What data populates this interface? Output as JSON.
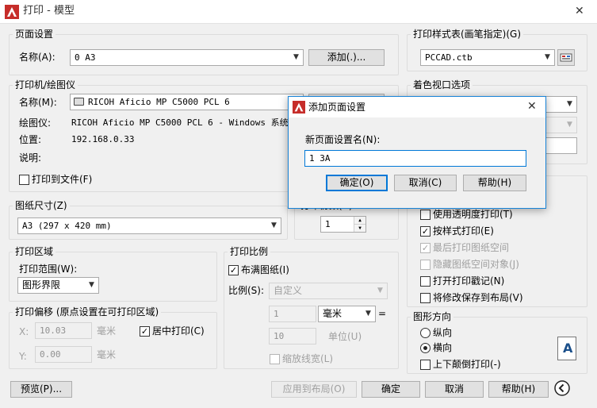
{
  "window": {
    "title": "打印 - 模型",
    "close_glyph": "✕"
  },
  "page_setup": {
    "title": "页面设置",
    "name_label": "名称(A):",
    "name_value": "0  A3",
    "add_button": "添加(.)..."
  },
  "printer": {
    "title": "打印机/绘图仪",
    "name_label": "名称(M):",
    "name_value": "RICOH Aficio MP C5000 PCL 6",
    "plotter_label": "绘图仪:",
    "plotter_value": "RICOH Aficio MP C5000 PCL 6 - Windows 系统...",
    "location_label": "位置:",
    "location_value": "192.168.0.33",
    "desc_label": "说明:",
    "print_to_file": "打印到文件(F)"
  },
  "paper_size": {
    "title": "图纸尺寸(Z)",
    "value": "A3 (297 x 420 mm)"
  },
  "copies": {
    "title": "打印份数(B)",
    "value": "1"
  },
  "plot_area": {
    "title": "打印区域",
    "range_label": "打印范围(W):",
    "range_value": "图形界限"
  },
  "plot_offset": {
    "title": "打印偏移 (原点设置在可打印区域)",
    "x_label": "X:",
    "x_value": "10.03",
    "x_unit": "毫米",
    "y_label": "Y:",
    "y_value": "0.00",
    "y_unit": "毫米",
    "center_label": "居中打印(C)"
  },
  "plot_scale": {
    "title": "打印比例",
    "fit_label": "布满图纸(I)",
    "scale_label": "比例(S):",
    "scale_value": "自定义",
    "val1": "1",
    "unit_value": "毫米",
    "equals": "=",
    "val2": "10",
    "unit2_label": "单位(U)",
    "lineweights_label": "缩放线宽(L)"
  },
  "plot_style": {
    "title": "打印样式表(画笔指定)(G)",
    "value": "PCCAD.ctb"
  },
  "shaded_viewport": {
    "title": "着色视口选项"
  },
  "plot_options": {
    "items": [
      {
        "label": "使用透明度打印(T)",
        "checked": false,
        "disabled": false
      },
      {
        "label": "按样式打印(E)",
        "checked": true,
        "disabled": false
      },
      {
        "label": "最后打印图纸空间",
        "checked": true,
        "disabled": true
      },
      {
        "label": "隐藏图纸空间对象(J)",
        "checked": false,
        "disabled": true
      },
      {
        "label": "打开打印戳记(N)",
        "checked": false,
        "disabled": false
      },
      {
        "label": "将修改保存到布局(V)",
        "checked": false,
        "disabled": false
      }
    ]
  },
  "orientation": {
    "title": "图形方向",
    "portrait": "纵向",
    "landscape": "横向",
    "upside_down": "上下颠倒打印(-)",
    "icon_letter": "A"
  },
  "bottom": {
    "preview": "预览(P)...",
    "apply_layout": "应用到布局(O)",
    "ok": "确定",
    "cancel": "取消",
    "help": "帮助(H)"
  },
  "dialog": {
    "title": "添加页面设置",
    "label": "新页面设置名(N):",
    "input_value": "1 3A",
    "ok": "确定(O)",
    "cancel": "取消(C)",
    "help": "帮助(H)"
  },
  "colors": {
    "accent": "#0078d7",
    "logo_red": "#c62d2a"
  }
}
